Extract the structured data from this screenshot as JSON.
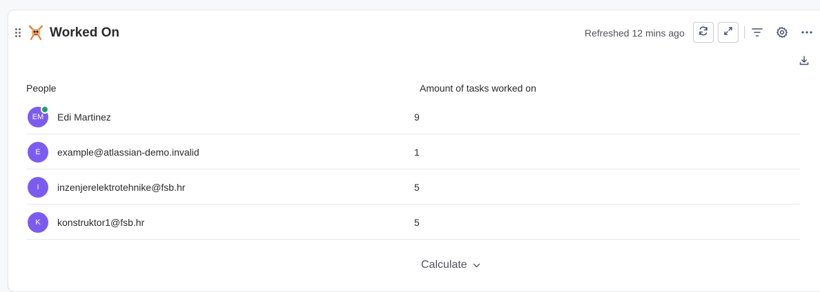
{
  "header": {
    "title": "Worked On",
    "emoji_icon": "robot-emoji-icon",
    "refreshed_text": "Refreshed 12 mins ago"
  },
  "toolbar": {
    "icons": [
      "drag-handle-icon",
      "refresh-icon",
      "expand-icon",
      "filter-icon",
      "gear-icon",
      "more-icon",
      "download-icon"
    ]
  },
  "table": {
    "columns": [
      "People",
      "Amount of tasks worked on"
    ],
    "rows": [
      {
        "initials": "EM",
        "name": "Edi Martinez",
        "amount": "9",
        "online": true
      },
      {
        "initials": "E",
        "name": "example@atlassian-demo.invalid",
        "amount": "1",
        "online": false
      },
      {
        "initials": "I",
        "name": "inzenjerelektrotehnike@fsb.hr",
        "amount": "5",
        "online": false
      },
      {
        "initials": "K",
        "name": "konstruktor1@fsb.hr",
        "amount": "5",
        "online": false
      }
    ]
  },
  "footer": {
    "calculate_label": "Calculate"
  },
  "colors": {
    "avatar": "#7c5cf0",
    "presence": "#22a06b",
    "border": "#e6e7ea",
    "text": "#292a2e"
  }
}
